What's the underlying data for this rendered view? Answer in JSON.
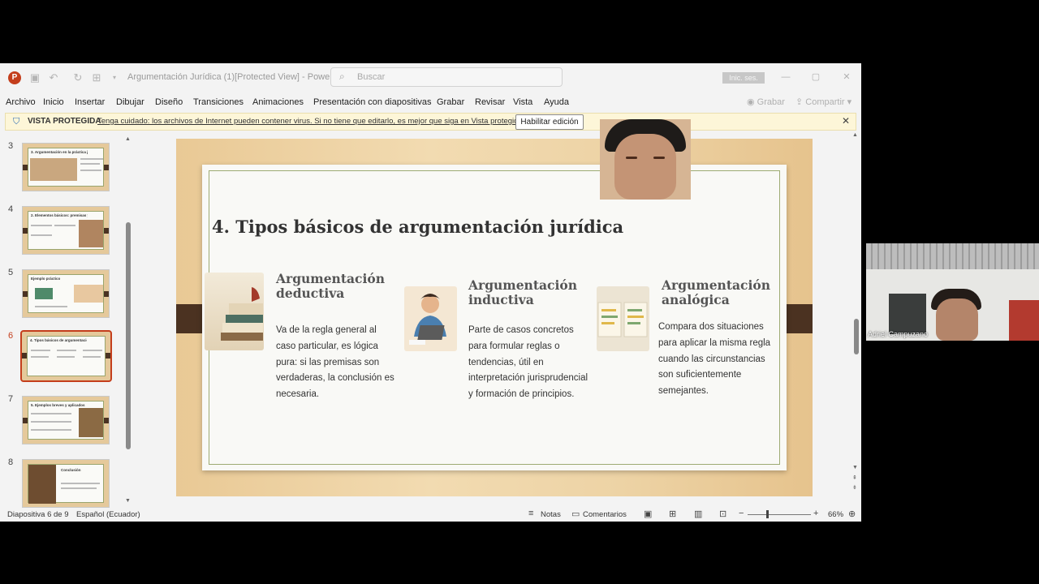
{
  "window": {
    "title": "Argumentación Jurídica (1)[Protected View] - PowerP...",
    "search_placeholder": "Buscar",
    "sign_in": "Inic. ses."
  },
  "ribbon": {
    "tabs": [
      "Archivo",
      "Inicio",
      "Insertar",
      "Dibujar",
      "Diseño",
      "Transiciones",
      "Animaciones",
      "Presentación con diapositivas",
      "Grabar",
      "Revisar",
      "Vista",
      "Ayuda"
    ],
    "record": "Grabar",
    "share": "Compartir"
  },
  "banner": {
    "label": "VISTA PROTEGIDA",
    "message": "Tenga cuidado: los archivos de Internet pueden contener virus. Si no tiene que editarlo, es mejor que siga en Vista protegida.",
    "enable_button": "Habilitar edición"
  },
  "thumbnails": [
    {
      "num": "3",
      "title": "3. Argumentación en la práctica judicial"
    },
    {
      "num": "4",
      "title": "2. Elementos básicos: premisas y conclusión"
    },
    {
      "num": "5",
      "title": "Ejemplo práctico"
    },
    {
      "num": "6",
      "title": "4. Tipos básicos de argumentación jurídica"
    },
    {
      "num": "7",
      "title": "5. Ejemplos breves y aplicados"
    },
    {
      "num": "8",
      "title": "Conclusión"
    }
  ],
  "slide": {
    "title": "4. Tipos básicos de argumentación jurídica",
    "columns": [
      {
        "heading": "Argumentación deductiva",
        "text": "Va de la regla general al caso particular, es lógica pura: si las premisas son verdaderas, la conclusión es necesaria."
      },
      {
        "heading": "Argumentación inductiva",
        "text": "Parte de casos concretos para formular reglas o tendencias, útil en interpretación jurisprudencial y formación de principios."
      },
      {
        "heading": "Argumentación analógica",
        "text": "Compara dos situaciones para aplicar la misma regla cuando las circunstancias son suficientemente semejantes."
      }
    ]
  },
  "status": {
    "slide_info": "Diapositiva 6 de 9",
    "language": "Español (Ecuador)",
    "notes": "Notas",
    "comments": "Comentarios",
    "zoom": "66%"
  },
  "webcam": {
    "participant_name": "Adriel Campuzano"
  }
}
